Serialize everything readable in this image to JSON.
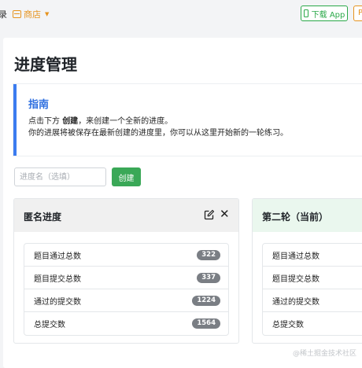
{
  "topbar": {
    "cut_text": "录",
    "store_label": "商店",
    "download_label": "下载 App",
    "cut_button_label": "P"
  },
  "page": {
    "title": "进度管理"
  },
  "guide": {
    "title": "指南",
    "line1_prefix": "点击下方 ",
    "line1_bold": "创建",
    "line1_suffix": "，来创建一个全新的进度。",
    "line2": "你的进展将被保存在最新创建的进度里，你可以从这里开始新的一轮练习。"
  },
  "form": {
    "name_placeholder": "进度名（选填）",
    "create_label": "创建"
  },
  "cards": [
    {
      "title": "匿名进度",
      "stats": [
        {
          "label": "题目通过总数",
          "value": "322"
        },
        {
          "label": "题目提交总数",
          "value": "337"
        },
        {
          "label": "通过的提交数",
          "value": "1224"
        },
        {
          "label": "总提交数",
          "value": "1564"
        }
      ]
    },
    {
      "title": "第二轮（当前）",
      "stats": [
        {
          "label": "题目通过总数"
        },
        {
          "label": "题目提交总数"
        },
        {
          "label": "通过的提交数"
        },
        {
          "label": "总提交数"
        }
      ]
    }
  ],
  "watermark": "@稀土掘金技术社区",
  "colors": {
    "accent_green": "#3aa857",
    "accent_blue": "#3b7cf0",
    "accent_orange": "#e6931e",
    "badge_gray": "#7a7e84"
  }
}
